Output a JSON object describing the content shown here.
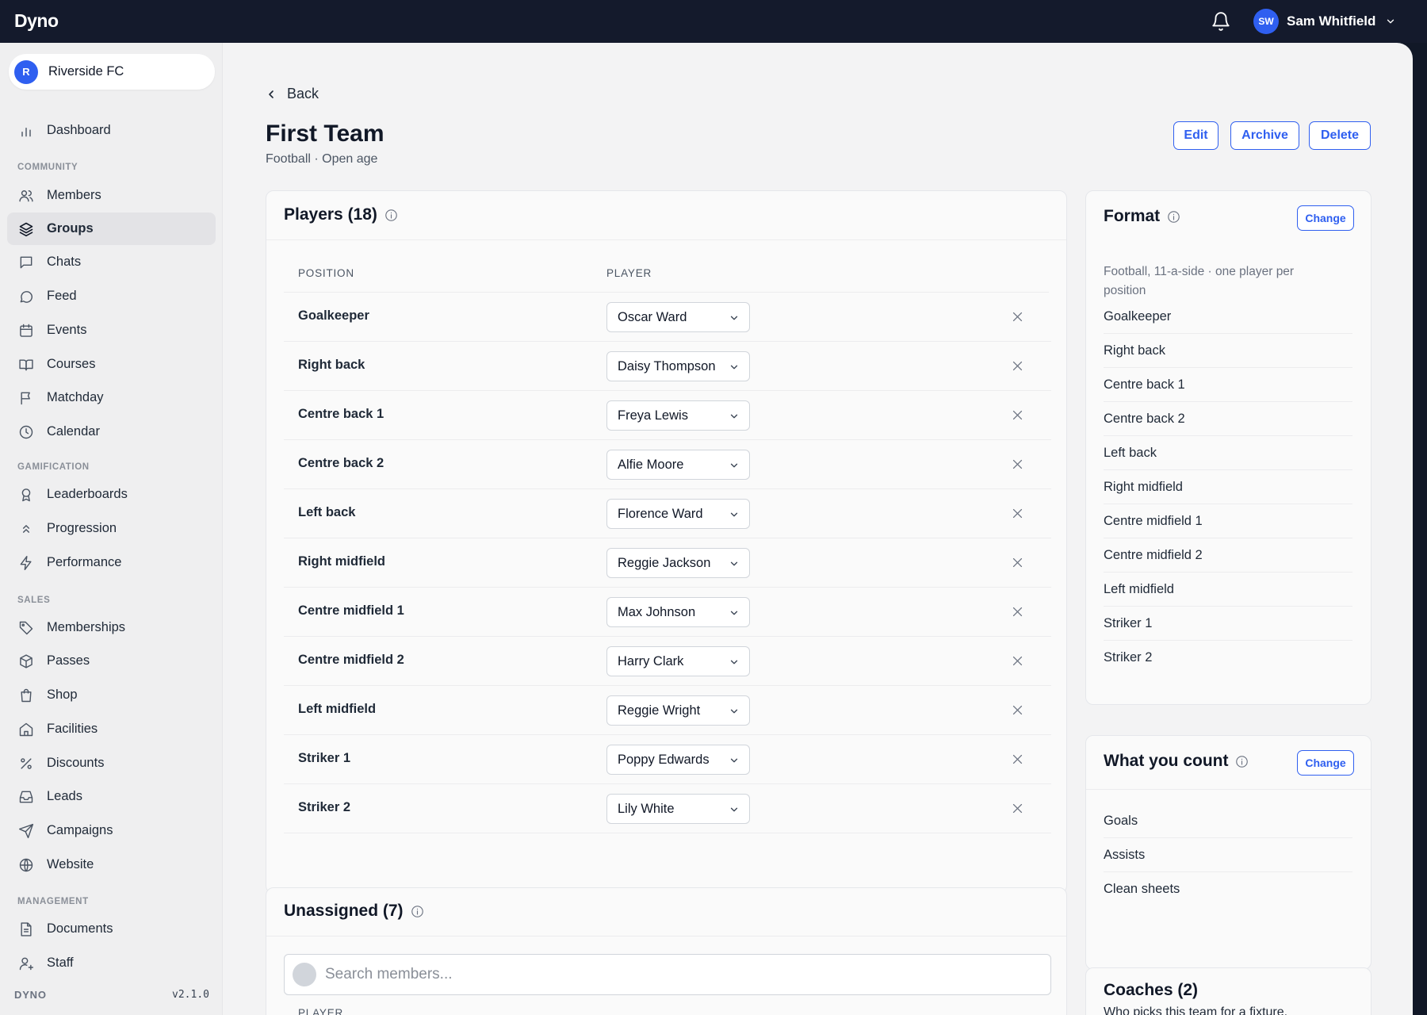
{
  "topbar": {
    "logo": "Dyno",
    "user_initials": "SW",
    "user_name": "Sam Whitfield"
  },
  "sidebar": {
    "org_initial": "R",
    "org_name": "Riverside FC",
    "dashboard": "Dashboard",
    "sections": {
      "community": "COMMUNITY",
      "gamification": "GAMIFICATION",
      "sales": "SALES",
      "management": "MANAGEMENT"
    },
    "items": {
      "members": "Members",
      "groups": "Groups",
      "chats": "Chats",
      "feed": "Feed",
      "events": "Events",
      "courses": "Courses",
      "matchday": "Matchday",
      "calendar": "Calendar",
      "leaderboards": "Leaderboards",
      "progression": "Progression",
      "performance": "Performance",
      "memberships": "Memberships",
      "passes": "Passes",
      "shop": "Shop",
      "facilities": "Facilities",
      "discounts": "Discounts",
      "leads": "Leads",
      "campaigns": "Campaigns",
      "website": "Website",
      "documents": "Documents",
      "staff": "Staff"
    },
    "footer_brand": "DYNO",
    "footer_version": "v2.1.0"
  },
  "page": {
    "back_label": "Back",
    "title": "First Team",
    "subtitle": "Football · Open age",
    "edit_label": "Edit",
    "archive_label": "Archive",
    "delete_label": "Delete"
  },
  "players": {
    "heading": "Players (18)",
    "col_position": "POSITION",
    "col_player": "PLAYER",
    "rows": [
      {
        "position": "Goalkeeper",
        "player": "Oscar Ward"
      },
      {
        "position": "Right back",
        "player": "Daisy Thompson"
      },
      {
        "position": "Centre back 1",
        "player": "Freya Lewis"
      },
      {
        "position": "Centre back 2",
        "player": "Alfie Moore"
      },
      {
        "position": "Left back",
        "player": "Florence Ward"
      },
      {
        "position": "Right midfield",
        "player": "Reggie Jackson"
      },
      {
        "position": "Centre midfield 1",
        "player": "Max Johnson"
      },
      {
        "position": "Centre midfield 2",
        "player": "Harry Clark"
      },
      {
        "position": "Left midfield",
        "player": "Reggie Wright"
      },
      {
        "position": "Striker 1",
        "player": "Poppy Edwards"
      },
      {
        "position": "Striker 2",
        "player": "Lily White"
      }
    ]
  },
  "unassigned": {
    "heading": "Unassigned (7)",
    "search_placeholder": "Search members...",
    "col_player": "PLAYER"
  },
  "format": {
    "heading": "Format",
    "change_label": "Change",
    "description": "Football, 11-a-side · one player per position",
    "positions": [
      "Goalkeeper",
      "Right back",
      "Centre back 1",
      "Centre back 2",
      "Left back",
      "Right midfield",
      "Centre midfield 1",
      "Centre midfield 2",
      "Left midfield",
      "Striker 1",
      "Striker 2"
    ]
  },
  "count": {
    "heading": "What you count",
    "change_label": "Change",
    "items": [
      "Goals",
      "Assists",
      "Clean sheets"
    ]
  },
  "coaches": {
    "heading": "Coaches (2)",
    "subtitle": "Who picks this team for a fixture."
  },
  "colors": {
    "accent": "#2f5ff0",
    "topbar": "#141a2c",
    "background": "#f3f3f4"
  }
}
